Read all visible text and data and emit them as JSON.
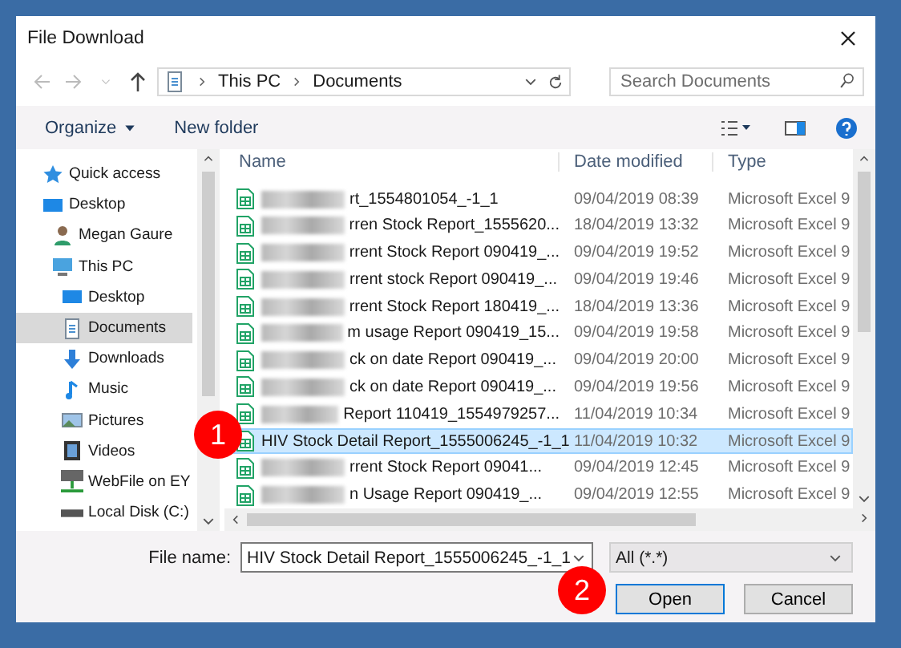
{
  "window": {
    "title": "File Download"
  },
  "address": {
    "path": [
      "This PC",
      "Documents"
    ],
    "search_placeholder": "Search Documents"
  },
  "toolbar": {
    "organize": "Organize",
    "new_folder": "New folder"
  },
  "nav": [
    {
      "label": "Quick access",
      "kind": "star",
      "selected": false
    },
    {
      "label": "Desktop",
      "kind": "desktop",
      "selected": false,
      "children": [
        {
          "label": "Megan Gaure",
          "kind": "user",
          "selected": false
        },
        {
          "label": "This PC",
          "kind": "pc",
          "selected": false,
          "children": [
            {
              "label": "Desktop",
              "kind": "desktop",
              "selected": false
            },
            {
              "label": "Documents",
              "kind": "documents",
              "selected": true
            },
            {
              "label": "Downloads",
              "kind": "downloads",
              "selected": false
            },
            {
              "label": "Music",
              "kind": "music",
              "selected": false
            },
            {
              "label": "Pictures",
              "kind": "pictures",
              "selected": false
            },
            {
              "label": "Videos",
              "kind": "videos",
              "selected": false
            },
            {
              "label": "WebFile on EY",
              "kind": "network",
              "selected": false
            },
            {
              "label": "Local Disk (C:)",
              "kind": "disk",
              "selected": false
            }
          ]
        }
      ]
    }
  ],
  "table": {
    "columns": [
      "Name",
      "Date modified",
      "Type"
    ],
    "rows": [
      {
        "name": "rt_1554801054_-1_1",
        "blurred": true,
        "date": "09/04/2019 08:39",
        "type": "Microsoft Excel 9",
        "selected": false
      },
      {
        "name": "rren Stock Report_1555620...",
        "blurred": true,
        "date": "18/04/2019 13:32",
        "type": "Microsoft Excel 9",
        "selected": false
      },
      {
        "name": "rrent Stock Report 090419_...",
        "blurred": true,
        "date": "09/04/2019 19:52",
        "type": "Microsoft Excel 9",
        "selected": false
      },
      {
        "name": "rrent stock Report 090419_...",
        "blurred": true,
        "date": "09/04/2019 19:46",
        "type": "Microsoft Excel 9",
        "selected": false
      },
      {
        "name": "rrent Stock Report 180419_...",
        "blurred": true,
        "date": "18/04/2019 13:36",
        "type": "Microsoft Excel 9",
        "selected": false
      },
      {
        "name": "m usage Report 090419_15...",
        "blurred": true,
        "date": "09/04/2019 19:58",
        "type": "Microsoft Excel 9",
        "selected": false
      },
      {
        "name": "ck on date Report 090419_...",
        "blurred": true,
        "date": "09/04/2019 20:00",
        "type": "Microsoft Excel 9",
        "selected": false
      },
      {
        "name": "ck on date Report 090419_...",
        "blurred": true,
        "date": "09/04/2019 19:56",
        "type": "Microsoft Excel 9",
        "selected": false
      },
      {
        "name": "Report 110419_1554979257...",
        "blurred": true,
        "date": "11/04/2019 10:34",
        "type": "Microsoft Excel 9",
        "selected": false
      },
      {
        "name": "HIV Stock Detail Report_1555006245_-1_1",
        "blurred": false,
        "date": "11/04/2019 10:32",
        "type": "Microsoft Excel 9",
        "selected": true
      },
      {
        "name": "rrent Stock Report 09041...",
        "blurred": true,
        "date": "09/04/2019 12:45",
        "type": "Microsoft Excel 9",
        "selected": false
      },
      {
        "name": "n Usage Report 090419_...",
        "blurred": true,
        "date": "09/04/2019 12:55",
        "type": "Microsoft Excel 9",
        "selected": false
      }
    ]
  },
  "footer": {
    "file_name_label": "File name:",
    "file_name": "HIV Stock Detail Report_1555006245_-1_1",
    "filter": "All (*.*)",
    "open": "Open",
    "cancel": "Cancel"
  },
  "callouts_": [
    "1",
    "2"
  ]
}
